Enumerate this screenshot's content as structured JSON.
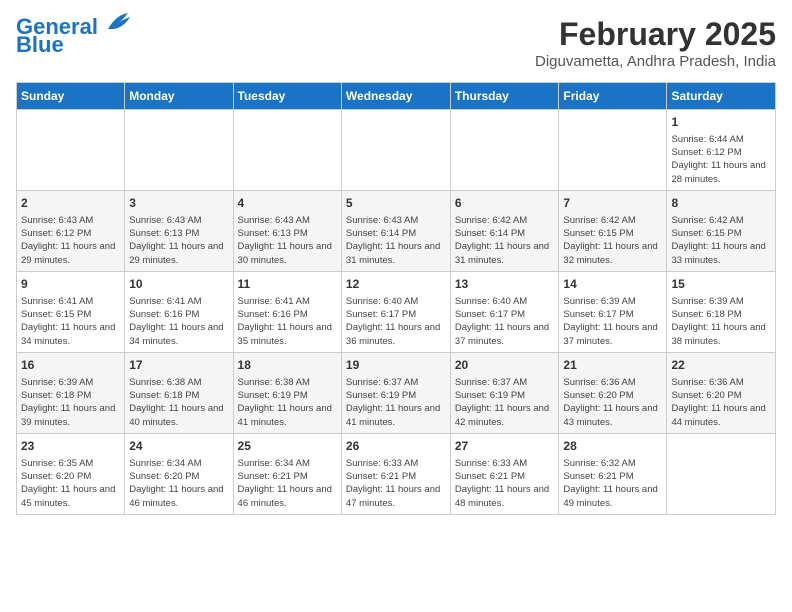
{
  "header": {
    "logo_line1": "General",
    "logo_line2": "Blue",
    "title": "February 2025",
    "subtitle": "Diguvametta, Andhra Pradesh, India"
  },
  "calendar": {
    "days_of_week": [
      "Sunday",
      "Monday",
      "Tuesday",
      "Wednesday",
      "Thursday",
      "Friday",
      "Saturday"
    ],
    "weeks": [
      [
        {
          "num": "",
          "info": ""
        },
        {
          "num": "",
          "info": ""
        },
        {
          "num": "",
          "info": ""
        },
        {
          "num": "",
          "info": ""
        },
        {
          "num": "",
          "info": ""
        },
        {
          "num": "",
          "info": ""
        },
        {
          "num": "1",
          "info": "Sunrise: 6:44 AM\nSunset: 6:12 PM\nDaylight: 11 hours and 28 minutes."
        }
      ],
      [
        {
          "num": "2",
          "info": "Sunrise: 6:43 AM\nSunset: 6:12 PM\nDaylight: 11 hours and 29 minutes."
        },
        {
          "num": "3",
          "info": "Sunrise: 6:43 AM\nSunset: 6:13 PM\nDaylight: 11 hours and 29 minutes."
        },
        {
          "num": "4",
          "info": "Sunrise: 6:43 AM\nSunset: 6:13 PM\nDaylight: 11 hours and 30 minutes."
        },
        {
          "num": "5",
          "info": "Sunrise: 6:43 AM\nSunset: 6:14 PM\nDaylight: 11 hours and 31 minutes."
        },
        {
          "num": "6",
          "info": "Sunrise: 6:42 AM\nSunset: 6:14 PM\nDaylight: 11 hours and 31 minutes."
        },
        {
          "num": "7",
          "info": "Sunrise: 6:42 AM\nSunset: 6:15 PM\nDaylight: 11 hours and 32 minutes."
        },
        {
          "num": "8",
          "info": "Sunrise: 6:42 AM\nSunset: 6:15 PM\nDaylight: 11 hours and 33 minutes."
        }
      ],
      [
        {
          "num": "9",
          "info": "Sunrise: 6:41 AM\nSunset: 6:15 PM\nDaylight: 11 hours and 34 minutes."
        },
        {
          "num": "10",
          "info": "Sunrise: 6:41 AM\nSunset: 6:16 PM\nDaylight: 11 hours and 34 minutes."
        },
        {
          "num": "11",
          "info": "Sunrise: 6:41 AM\nSunset: 6:16 PM\nDaylight: 11 hours and 35 minutes."
        },
        {
          "num": "12",
          "info": "Sunrise: 6:40 AM\nSunset: 6:17 PM\nDaylight: 11 hours and 36 minutes."
        },
        {
          "num": "13",
          "info": "Sunrise: 6:40 AM\nSunset: 6:17 PM\nDaylight: 11 hours and 37 minutes."
        },
        {
          "num": "14",
          "info": "Sunrise: 6:39 AM\nSunset: 6:17 PM\nDaylight: 11 hours and 37 minutes."
        },
        {
          "num": "15",
          "info": "Sunrise: 6:39 AM\nSunset: 6:18 PM\nDaylight: 11 hours and 38 minutes."
        }
      ],
      [
        {
          "num": "16",
          "info": "Sunrise: 6:39 AM\nSunset: 6:18 PM\nDaylight: 11 hours and 39 minutes."
        },
        {
          "num": "17",
          "info": "Sunrise: 6:38 AM\nSunset: 6:18 PM\nDaylight: 11 hours and 40 minutes."
        },
        {
          "num": "18",
          "info": "Sunrise: 6:38 AM\nSunset: 6:19 PM\nDaylight: 11 hours and 41 minutes."
        },
        {
          "num": "19",
          "info": "Sunrise: 6:37 AM\nSunset: 6:19 PM\nDaylight: 11 hours and 41 minutes."
        },
        {
          "num": "20",
          "info": "Sunrise: 6:37 AM\nSunset: 6:19 PM\nDaylight: 11 hours and 42 minutes."
        },
        {
          "num": "21",
          "info": "Sunrise: 6:36 AM\nSunset: 6:20 PM\nDaylight: 11 hours and 43 minutes."
        },
        {
          "num": "22",
          "info": "Sunrise: 6:36 AM\nSunset: 6:20 PM\nDaylight: 11 hours and 44 minutes."
        }
      ],
      [
        {
          "num": "23",
          "info": "Sunrise: 6:35 AM\nSunset: 6:20 PM\nDaylight: 11 hours and 45 minutes."
        },
        {
          "num": "24",
          "info": "Sunrise: 6:34 AM\nSunset: 6:20 PM\nDaylight: 11 hours and 46 minutes."
        },
        {
          "num": "25",
          "info": "Sunrise: 6:34 AM\nSunset: 6:21 PM\nDaylight: 11 hours and 46 minutes."
        },
        {
          "num": "26",
          "info": "Sunrise: 6:33 AM\nSunset: 6:21 PM\nDaylight: 11 hours and 47 minutes."
        },
        {
          "num": "27",
          "info": "Sunrise: 6:33 AM\nSunset: 6:21 PM\nDaylight: 11 hours and 48 minutes."
        },
        {
          "num": "28",
          "info": "Sunrise: 6:32 AM\nSunset: 6:21 PM\nDaylight: 11 hours and 49 minutes."
        },
        {
          "num": "",
          "info": ""
        }
      ]
    ]
  }
}
